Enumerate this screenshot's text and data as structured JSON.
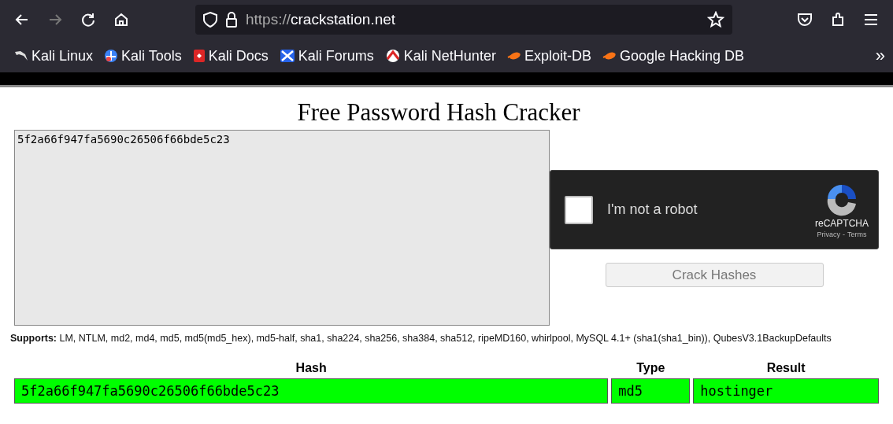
{
  "browser": {
    "url_scheme": "https://",
    "url_host": "crackstation.net",
    "bookmarks": [
      {
        "label": "Kali Linux",
        "kind": "dragon"
      },
      {
        "label": "Kali Tools",
        "kind": "tools"
      },
      {
        "label": "Kali Docs",
        "kind": "docs"
      },
      {
        "label": "Kali Forums",
        "kind": "forums"
      },
      {
        "label": "Kali NetHunter",
        "kind": "nethunter"
      },
      {
        "label": "Exploit-DB",
        "kind": "exploit"
      },
      {
        "label": "Google Hacking DB",
        "kind": "exploit"
      }
    ],
    "overflow": "»"
  },
  "page": {
    "title": "Free Password Hash Cracker",
    "hash_input": "5f2a66f947fa5690c26506f66bde5c23",
    "captcha": {
      "label": "I'm not a robot",
      "checked": false,
      "brand": "reCAPTCHA",
      "privacy": "Privacy",
      "separator": "-",
      "terms": "Terms"
    },
    "crack_button": {
      "label": "Crack Hashes",
      "disabled": true
    },
    "supports": "**Supports:** LM, NTLM, md2, md4, md5, md5(md5_hex), md5-half, sha1, sha224, sha256, sha384, sha512, ripeMD160, whirlpool, MySQL 4.1+ (sha1(sha1_bin)), QubesV3.1BackupDefaults",
    "results": {
      "columns": [
        "Hash",
        "Type",
        "Result"
      ],
      "rows": [
        {
          "cells": [
            "5f2a66f947fa5690c26506f66bde5c23",
            "md5",
            "hostinger"
          ],
          "color": "#00ff00"
        }
      ]
    }
  }
}
